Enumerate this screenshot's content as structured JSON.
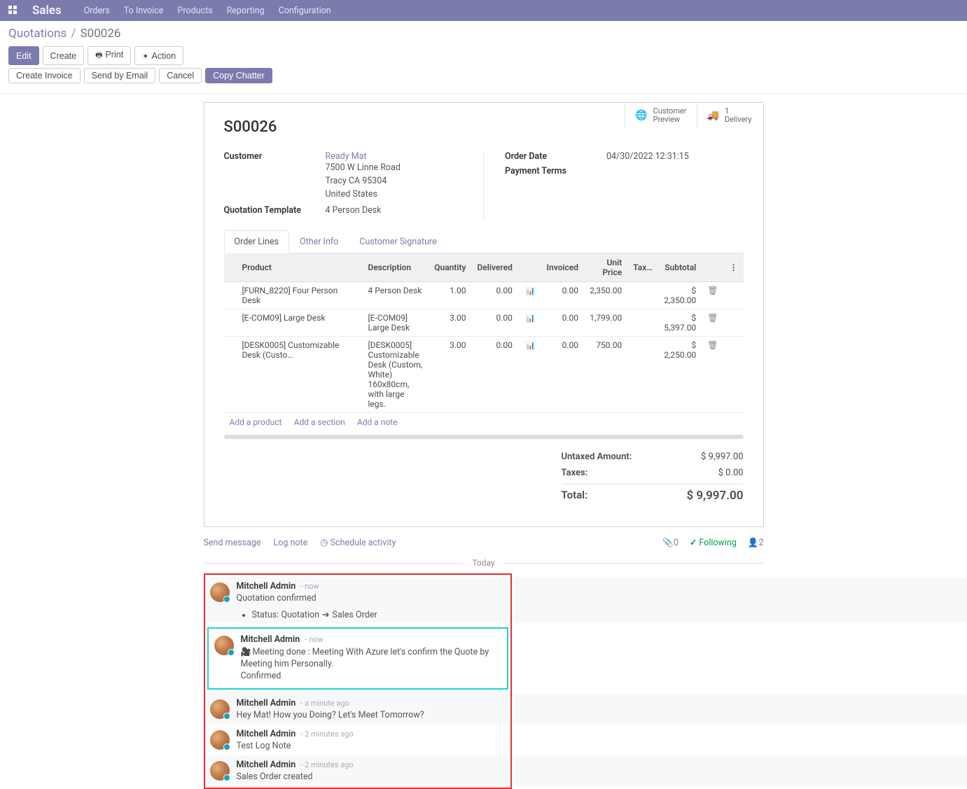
{
  "topnav": {
    "brand": "Sales",
    "links": [
      "Orders",
      "To Invoice",
      "Products",
      "Reporting",
      "Configuration"
    ]
  },
  "breadcrumb": {
    "root": "Quotations",
    "sep": "/",
    "current": "S00026"
  },
  "toolbar1": {
    "edit": "Edit",
    "create": "Create",
    "print": "Print",
    "action": "Action"
  },
  "toolbar2": {
    "create_invoice": "Create Invoice",
    "send_email": "Send by Email",
    "cancel": "Cancel",
    "copy_chatter": "Copy Chatter"
  },
  "stat": {
    "customer_preview_top": "Customer",
    "customer_preview_bot": "Preview",
    "delivery_top": "1",
    "delivery_bot": "Delivery"
  },
  "order": {
    "name": "S00026",
    "labels": {
      "customer": "Customer",
      "quotation_template": "Quotation Template",
      "order_date": "Order Date",
      "payment_terms": "Payment Terms"
    },
    "customer_name": "Ready Mat",
    "addr1": "7500 W Linne Road",
    "addr2": "Tracy CA 95304",
    "addr3": "United States",
    "quotation_template": "4 Person Desk",
    "order_date": "04/30/2022 12:31:15",
    "payment_terms": ""
  },
  "tabs": {
    "order_lines": "Order Lines",
    "other_info": "Other Info",
    "customer_signature": "Customer Signature"
  },
  "table": {
    "headers": {
      "product": "Product",
      "description": "Description",
      "quantity": "Quantity",
      "delivered": "Delivered",
      "invoiced": "Invoiced",
      "unit_price": "Unit Price",
      "taxes": "Tax…",
      "subtotal": "Subtotal"
    },
    "rows": [
      {
        "product": "[FURN_8220] Four Person Desk",
        "description": "4 Person Desk",
        "quantity": "1.00",
        "delivered": "0.00",
        "stock_color": "red",
        "invoiced": "0.00",
        "unit_price": "2,350.00",
        "taxes": "",
        "subtotal": "$ 2,350.00"
      },
      {
        "product": "[E-COM09] Large Desk",
        "description": "[E-COM09] Large Desk",
        "quantity": "3.00",
        "delivered": "0.00",
        "stock_color": "red",
        "invoiced": "0.00",
        "unit_price": "1,799.00",
        "taxes": "",
        "subtotal": "$ 5,397.00"
      },
      {
        "product": "[DESK0005] Customizable Desk (Custo…",
        "description": "[DESK0005] Customizable Desk (Custom, White)\n160x80cm, with large legs.",
        "quantity": "3.00",
        "delivered": "0.00",
        "stock_color": "blue",
        "invoiced": "0.00",
        "unit_price": "750.00",
        "taxes": "",
        "subtotal": "$ 2,250.00"
      }
    ],
    "add_links": {
      "product": "Add a product",
      "section": "Add a section",
      "note": "Add a note"
    }
  },
  "totals": {
    "untaxed_label": "Untaxed Amount:",
    "untaxed_value": "$ 9,997.00",
    "taxes_label": "Taxes:",
    "taxes_value": "$ 0.00",
    "total_label": "Total:",
    "total_value": "$ 9,997.00"
  },
  "chatter": {
    "send_message": "Send message",
    "log_note": "Log note",
    "schedule_activity": "Schedule activity",
    "attachments": "0",
    "following": "Following",
    "followers": "2",
    "separator": "Today"
  },
  "messages": [
    {
      "author": "Mitchell Admin",
      "time": "- now",
      "line1": "Quotation confirmed",
      "status_from": "Status: Quotation",
      "status_to": "Sales Order",
      "strip": "even"
    },
    {
      "author": "Mitchell Admin",
      "time": "- now",
      "line1": "Meeting done : Meeting With Azure let's confirm the Quote by Meeting him Personally.",
      "line2": "Confirmed",
      "has_cam": true,
      "cyan_box": true,
      "strip": "odd"
    },
    {
      "author": "Mitchell Admin",
      "time": "- a minute ago",
      "line1": "Hey Mat! How you Doing? Let's Meet Tomorrow?",
      "strip": "even"
    },
    {
      "author": "Mitchell Admin",
      "time": "- 2 minutes ago",
      "line1": "Test Log Note",
      "strip": "odd"
    },
    {
      "author": "Mitchell Admin",
      "time": "- 2 minutes ago",
      "line1": "Sales Order created",
      "strip": "even"
    }
  ]
}
